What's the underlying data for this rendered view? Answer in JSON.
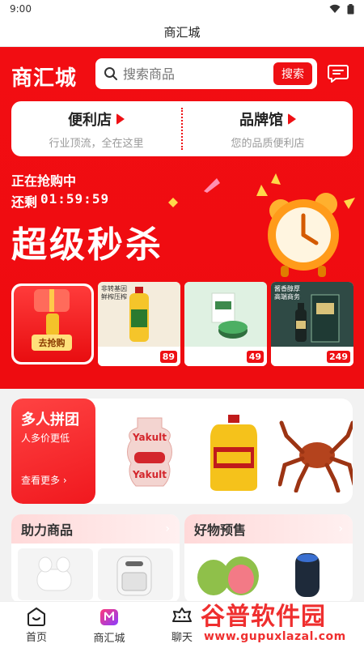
{
  "status_bar": {
    "time": "9:00"
  },
  "app_title": "商汇城",
  "header": {
    "logo": "商汇城",
    "search_placeholder": "搜索商品",
    "search_button": "搜索"
  },
  "stores": [
    {
      "title": "便利店",
      "subtitle": "行业顶流，全在这里"
    },
    {
      "title": "品牌馆",
      "subtitle": "您的品质便利店"
    }
  ],
  "flash_sale": {
    "status": "正在抢购中",
    "remaining_label": "还剩",
    "remaining_time": "01:59:59",
    "title": "超级秒杀",
    "go_button": "去抢购",
    "products": [
      {
        "tag": "非转基因\n鲜榨压榨",
        "price": "89",
        "bg": "#f4ecdc"
      },
      {
        "tag": "",
        "price": "49",
        "bg": "#dff1e2"
      },
      {
        "tag": "酱香醇厚\n高端商务",
        "price": "249",
        "bg": "#2f4a45"
      }
    ]
  },
  "group_buy": {
    "title": "多人拼团",
    "subtitle": "人多价更低",
    "more": "查看更多 ›"
  },
  "sections": [
    {
      "title": "助力商品"
    },
    {
      "title": "好物预售"
    }
  ],
  "tabbar": [
    {
      "label": "首页",
      "icon": "home-icon"
    },
    {
      "label": "商汇城",
      "icon": "mall-icon"
    },
    {
      "label": "聊天",
      "icon": "chat-icon"
    }
  ],
  "watermark": {
    "big": "谷普软件园",
    "small": "www.gupuxlazal.com"
  },
  "colors": {
    "accent": "#ee1014",
    "background": "#f2f2f2"
  }
}
